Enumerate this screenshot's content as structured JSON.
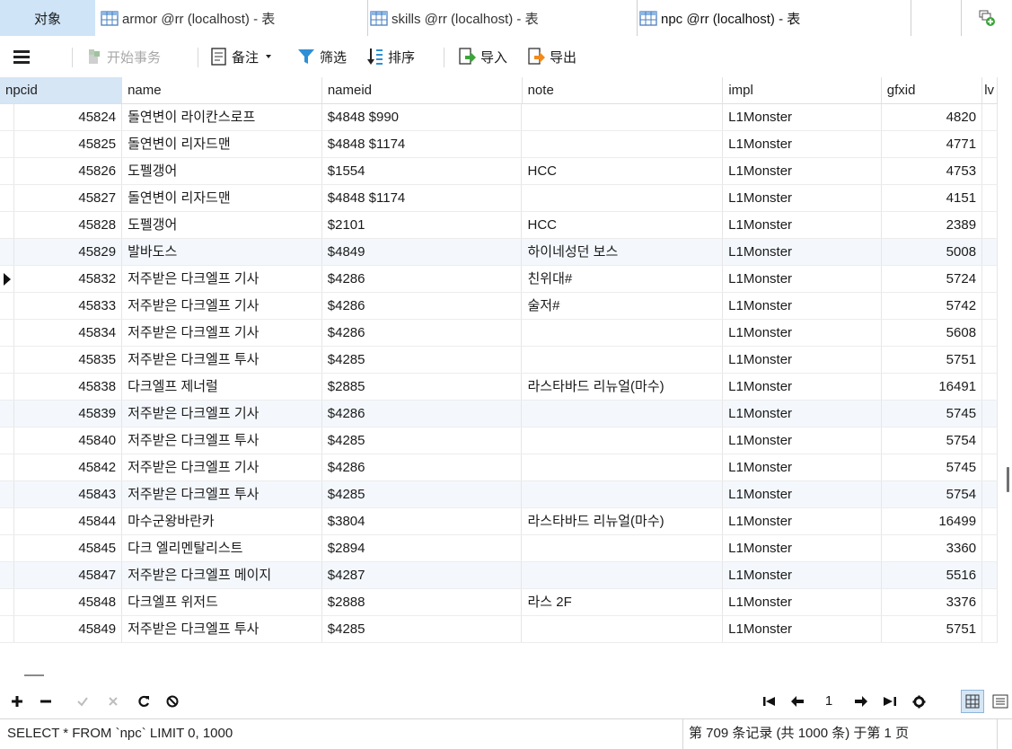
{
  "tabs": {
    "objects": "对象",
    "armor": "armor @rr (localhost) - 表",
    "skills": "skills @rr (localhost) - 表",
    "npc": "npc @rr (localhost) - 表"
  },
  "toolbar": {
    "begin_transaction": "开始事务",
    "memo": "备注",
    "filter": "筛选",
    "sort": "排序",
    "import": "导入",
    "export": "导出"
  },
  "columns": [
    "npcid",
    "name",
    "nameid",
    "note",
    "impl",
    "gfxid",
    "lv"
  ],
  "rows": [
    {
      "npcid": "45824",
      "name": "돌연변이 라이칸스로프",
      "nameid": "$4848 $990",
      "note": "",
      "impl": "L1Monster",
      "gfxid": "4820"
    },
    {
      "npcid": "45825",
      "name": "돌연변이 리자드맨",
      "nameid": "$4848 $1174",
      "note": "",
      "impl": "L1Monster",
      "gfxid": "4771"
    },
    {
      "npcid": "45826",
      "name": "도펠갱어",
      "nameid": "$1554",
      "note": "HCC",
      "impl": "L1Monster",
      "gfxid": "4753"
    },
    {
      "npcid": "45827",
      "name": "돌연변이 리자드맨",
      "nameid": "$4848 $1174",
      "note": "",
      "impl": "L1Monster",
      "gfxid": "4151"
    },
    {
      "npcid": "45828",
      "name": "도펠갱어",
      "nameid": "$2101",
      "note": "HCC",
      "impl": "L1Monster",
      "gfxid": "2389"
    },
    {
      "npcid": "45829",
      "name": "발바도스",
      "nameid": "$4849",
      "note": "하이네성던 보스",
      "impl": "L1Monster",
      "gfxid": "5008"
    },
    {
      "npcid": "45832",
      "name": "저주받은 다크엘프 기사",
      "nameid": "$4286",
      "note": "친위대#",
      "impl": "L1Monster",
      "gfxid": "5724"
    },
    {
      "npcid": "45833",
      "name": "저주받은 다크엘프 기사",
      "nameid": "$4286",
      "note": "술저#",
      "impl": "L1Monster",
      "gfxid": "5742"
    },
    {
      "npcid": "45834",
      "name": "저주받은 다크엘프 기사",
      "nameid": "$4286",
      "note": "",
      "impl": "L1Monster",
      "gfxid": "5608"
    },
    {
      "npcid": "45835",
      "name": "저주받은 다크엘프 투사",
      "nameid": "$4285",
      "note": "",
      "impl": "L1Monster",
      "gfxid": "5751"
    },
    {
      "npcid": "45838",
      "name": "다크엘프 제너럴",
      "nameid": "$2885",
      "note": "라스타바드 리뉴얼(마수)",
      "impl": "L1Monster",
      "gfxid": "16491"
    },
    {
      "npcid": "45839",
      "name": "저주받은 다크엘프 기사",
      "nameid": "$4286",
      "note": "",
      "impl": "L1Monster",
      "gfxid": "5745"
    },
    {
      "npcid": "45840",
      "name": "저주받은 다크엘프 투사",
      "nameid": "$4285",
      "note": "",
      "impl": "L1Monster",
      "gfxid": "5754"
    },
    {
      "npcid": "45842",
      "name": "저주받은 다크엘프 기사",
      "nameid": "$4286",
      "note": "",
      "impl": "L1Monster",
      "gfxid": "5745"
    },
    {
      "npcid": "45843",
      "name": "저주받은 다크엘프 투사",
      "nameid": "$4285",
      "note": "",
      "impl": "L1Monster",
      "gfxid": "5754"
    },
    {
      "npcid": "45844",
      "name": "마수군왕바란카",
      "nameid": "$3804",
      "note": "라스타바드 리뉴얼(마수)",
      "impl": "L1Monster",
      "gfxid": "16499"
    },
    {
      "npcid": "45845",
      "name": "다크 엘리멘탈리스트",
      "nameid": "$2894",
      "note": "",
      "impl": "L1Monster",
      "gfxid": "3360"
    },
    {
      "npcid": "45847",
      "name": "저주받은 다크엘프 메이지",
      "nameid": "$4287",
      "note": "",
      "impl": "L1Monster",
      "gfxid": "5516"
    },
    {
      "npcid": "45848",
      "name": "다크엘프 위저드",
      "nameid": "$2888",
      "note": "라스 2F",
      "impl": "L1Monster",
      "gfxid": "3376"
    },
    {
      "npcid": "45849",
      "name": "저주받은 다크엘프 투사",
      "nameid": "$4285",
      "note": "",
      "impl": "L1Monster",
      "gfxid": "5751"
    }
  ],
  "selected_row": 6,
  "pager": {
    "page": "1"
  },
  "status": {
    "query": "SELECT * FROM `npc` LIMIT 0, 1000",
    "record_info": "第 709 条记录 (共 1000 条) 于第 1 页"
  },
  "colors": {
    "accent": "#cfe4f7",
    "header_active": "#d6e6f5",
    "alt_row": "#f4f8fc"
  }
}
